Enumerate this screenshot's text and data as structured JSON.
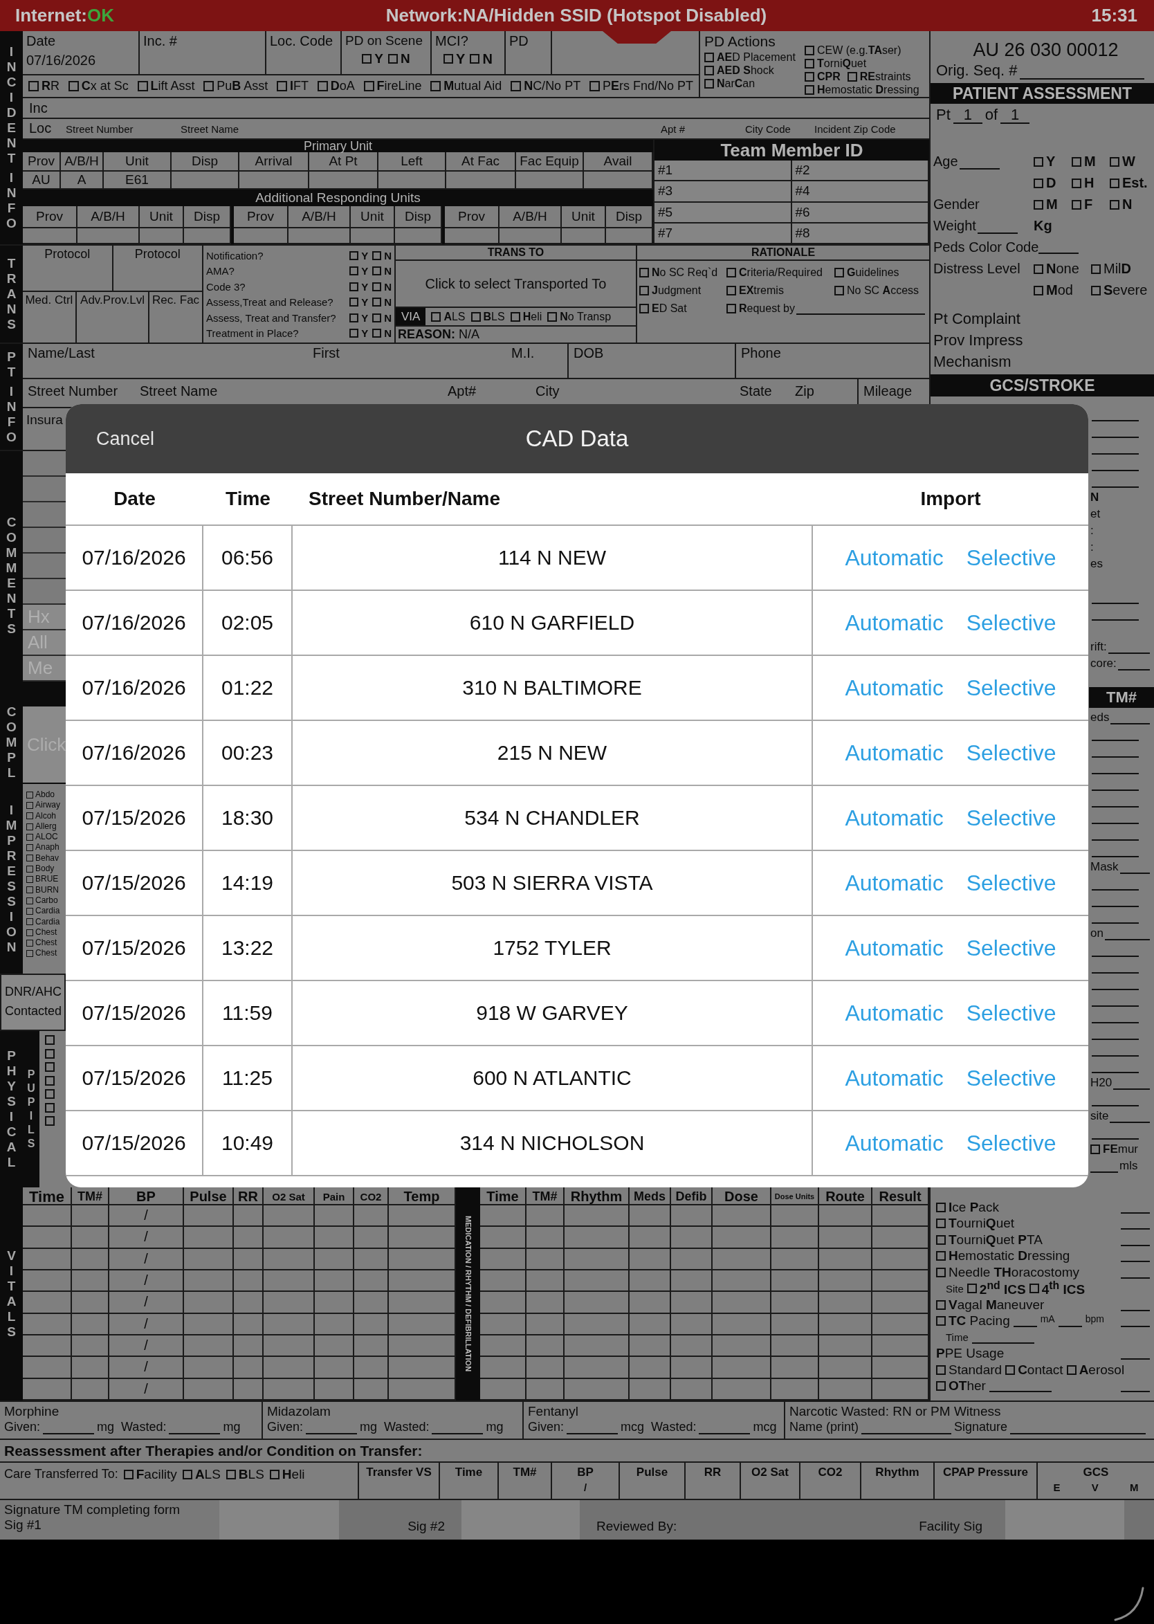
{
  "status_bar": {
    "internet_label": "Internet:",
    "internet_status": "OK",
    "network": "Network:NA/Hidden SSID (Hotspot Disabled)",
    "time": "15:31"
  },
  "side_labels": [
    "INCIDENT INFO",
    "TRANS",
    "PT INFO",
    "COMMENTS",
    "COMPL",
    "IMPRESSION",
    "PHYSICAL",
    "VITALS"
  ],
  "incident": {
    "date_label": "Date",
    "date": "07/16/2026",
    "inc_number_label": "Inc. #",
    "loc_code_label": "Loc. Code",
    "pd_on_scene": {
      "label": "PD on Scene",
      "options": [
        {
          "label": "Y",
          "checked": false
        },
        {
          "label": "N",
          "checked": false
        }
      ]
    },
    "mci": {
      "label": "MCI?",
      "options": [
        {
          "label": "Y",
          "checked": false
        },
        {
          "label": "N",
          "checked": false
        }
      ]
    },
    "pd_label": "PD",
    "pd_actions": {
      "label": "PD Actions",
      "items": [
        {
          "label": "**AE**D Placement",
          "checked": false
        },
        {
          "label": "**AED S**hock",
          "checked": false
        },
        {
          "label": "**N**ar**C**an",
          "checked": false
        },
        {
          "label": "CEW (e.g.**TA**ser)",
          "checked": false
        },
        {
          "label": "**T**orni**Q**uet",
          "checked": false
        },
        {
          "label": "**CPR**",
          "checked": false
        },
        {
          "label": "**RE**straints",
          "checked": false
        },
        {
          "label": "**H**emostatic **D**ressing",
          "checked": false
        }
      ]
    },
    "flags": [
      {
        "label": "**R**R",
        "checked": false
      },
      {
        "label": "**C**x at Sc",
        "checked": false
      },
      {
        "label": "**L**ift Asst",
        "checked": false
      },
      {
        "label": "Pu**B** Asst",
        "checked": false
      },
      {
        "label": "**I**FT",
        "checked": false
      },
      {
        "label": "**D**oA",
        "checked": false
      },
      {
        "label": "**F**ireLine",
        "checked": false
      },
      {
        "label": "**M**utual Aid",
        "checked": false
      },
      {
        "label": "**N**C/No PT",
        "checked": false
      },
      {
        "label": "P**E**rs Fnd/No PT",
        "checked": false
      }
    ],
    "inc_label": "Inc",
    "loc_label": "Loc",
    "loc_fields": [
      "Street Number",
      "Street Name",
      "Apt #",
      "City Code",
      "Incident Zip Code"
    ],
    "primary_unit": {
      "title": "Primary Unit",
      "columns": [
        "Prov",
        "A/B/H",
        "Unit",
        "Disp",
        "Arrival",
        "At Pt",
        "Left",
        "At Fac",
        "Fac Equip",
        "Avail"
      ],
      "values": [
        "AU",
        "A",
        "E61"
      ]
    },
    "additional_units": {
      "title": "Additional Responding Units",
      "groups": [
        [
          "Prov",
          "A/B/H",
          "Unit",
          "Disp"
        ],
        [
          "Prov",
          "A/B/H",
          "Unit",
          "Disp"
        ],
        [
          "Prov",
          "A/B/H",
          "Unit",
          "Disp"
        ]
      ]
    },
    "team": {
      "title": "Team Member ID",
      "slots": [
        "#1",
        "#2",
        "#3",
        "#4",
        "#5",
        "#6",
        "#7",
        "#8"
      ]
    }
  },
  "trans": {
    "protocol_labels": [
      "Protocol",
      "Protocol"
    ],
    "control_labels": [
      "Med. Ctrl",
      "Adv.Prov.Lvl",
      "Rec. Fac"
    ],
    "questions": [
      {
        "label": "Notification?",
        "options": [
          {
            "label": "Y",
            "checked": false
          },
          {
            "label": "N",
            "checked": false
          }
        ]
      },
      {
        "label": "AMA?",
        "options": [
          {
            "label": "Y",
            "checked": false
          },
          {
            "label": "N",
            "checked": false
          }
        ]
      },
      {
        "label": "Code 3?",
        "options": [
          {
            "label": "Y",
            "checked": false
          },
          {
            "label": "N",
            "checked": false
          }
        ]
      },
      {
        "label": "Assess,Treat and Release?",
        "options": [
          {
            "label": "Y",
            "checked": false
          },
          {
            "label": "N",
            "checked": false
          }
        ]
      },
      {
        "label": "Assess, Treat and Transfer?",
        "options": [
          {
            "label": "Y",
            "checked": false
          },
          {
            "label": "N",
            "checked": false
          }
        ]
      },
      {
        "label": "Treatment in Place?",
        "options": [
          {
            "label": "Y",
            "checked": false
          },
          {
            "label": "N",
            "checked": false
          }
        ]
      }
    ],
    "trans_to": {
      "title": "TRANS TO",
      "destination_button": "Click to select Transported To",
      "via_label": "VIA",
      "via_options": [
        {
          "label": "**A**LS",
          "checked": false
        },
        {
          "label": "**B**LS",
          "checked": false
        },
        {
          "label": "**H**eli",
          "checked": false
        },
        {
          "label": "**N**o Transp",
          "checked": false
        }
      ],
      "reason": "**REASON:** N/A"
    },
    "rationale": {
      "title": "RATIONALE",
      "options": [
        {
          "label": "**N**o SC Req`d",
          "checked": false
        },
        {
          "label": "**C**riteria/Required",
          "checked": false
        },
        {
          "label": "**G**uidelines",
          "checked": false
        },
        {
          "label": "**J**udgment",
          "checked": false
        },
        {
          "label": "**EX**tremis",
          "checked": false
        },
        {
          "label": "No SC **A**ccess",
          "checked": false
        },
        {
          "label": "**E**D Sat",
          "checked": false
        },
        {
          "label": "**R**equest by",
          "checked": false
        }
      ]
    }
  },
  "pt_info": {
    "name_fields": [
      "Name/Last",
      "First",
      "M.I.",
      "DOB",
      "Phone"
    ],
    "address_fields": [
      "Street Number",
      "Street Name",
      "Apt#",
      "City",
      "State",
      "Zip",
      "Mileage"
    ],
    "insurance_label": "Insura"
  },
  "assessment": {
    "record_number": "AU 26 030 00012",
    "orig_seq_label": "Orig. Seq. #",
    "title": "PATIENT ASSESSMENT",
    "pt_label": "Pt",
    "pt_number": "1",
    "of_label": "of",
    "pt_total": "1",
    "age_label": "Age",
    "age_options": [
      {
        "label": "Y",
        "checked": false
      },
      {
        "label": "M",
        "checked": false
      },
      {
        "label": "W",
        "checked": false
      },
      {
        "label": "D",
        "checked": false
      },
      {
        "label": "H",
        "checked": false
      },
      {
        "label": "Est.",
        "checked": false
      }
    ],
    "gender_label": "Gender",
    "gender_options": [
      {
        "label": "M",
        "checked": false
      },
      {
        "label": "F",
        "checked": false
      },
      {
        "label": "N",
        "checked": false
      }
    ],
    "weight_label": "Weight",
    "weight_unit": "Kg",
    "peds_color_label": "Peds Color Code",
    "distress_label": "Distress Level",
    "distress_options": [
      {
        "label": "**N**one",
        "checked": false
      },
      {
        "label": "Mil**D**",
        "checked": false
      },
      {
        "label": "**M**od",
        "checked": false
      },
      {
        "label": "**S**evere",
        "checked": false
      }
    ],
    "fields": [
      "Pt Complaint",
      "Prov Impress",
      "Mechanism"
    ],
    "gcs_title": "GCS/STROKE"
  },
  "right_strip": [
    {
      "text": "N",
      "kind": "bold"
    },
    {
      "text": "et",
      "kind": "text"
    },
    {
      "text": ":",
      "kind": "text"
    },
    {
      "text": ":",
      "kind": "text"
    },
    {
      "text": "es",
      "kind": "text"
    },
    {
      "text": "rift:",
      "kind": "field"
    },
    {
      "text": "core:",
      "kind": "field"
    },
    {
      "text": "TM#",
      "kind": "header"
    },
    {
      "text": "eds",
      "kind": "field"
    },
    {
      "text": "Mask",
      "kind": "field"
    },
    {
      "text": "on",
      "kind": "field"
    },
    {
      "text": "H20",
      "kind": "field"
    },
    {
      "text": "site",
      "kind": "field"
    },
    {
      "text": "**FE**mur",
      "kind": "check",
      "checked": false
    },
    {
      "text": "mls",
      "kind": "unit"
    }
  ],
  "comments": {
    "fields": [
      {
        "placeholder": "Hx"
      },
      {
        "placeholder": "All"
      },
      {
        "placeholder": "Me"
      }
    ]
  },
  "complaint": {
    "placeholder": "Click"
  },
  "impressions": [
    {
      "label": "Abdo",
      "checked": false
    },
    {
      "label": "Airway",
      "checked": false
    },
    {
      "label": "Alcoh",
      "checked": false
    },
    {
      "label": "Allerg",
      "checked": false
    },
    {
      "label": "ALOC",
      "checked": false
    },
    {
      "label": "Anaph",
      "checked": false
    },
    {
      "label": "Behav",
      "checked": false
    },
    {
      "label": "Body",
      "checked": false
    },
    {
      "label": "BRUE",
      "checked": false
    },
    {
      "label": "BURN",
      "checked": false
    },
    {
      "label": "Carbo",
      "checked": false
    },
    {
      "label": "Cardia",
      "checked": false
    },
    {
      "label": "Cardia",
      "checked": false
    },
    {
      "label": "Chest",
      "checked": false
    },
    {
      "label": "Chest",
      "checked": false
    },
    {
      "label": "Chest",
      "checked": false
    }
  ],
  "dnr": {
    "label": "DNR/AHC",
    "sublabel": "Contacted"
  },
  "pupils": {
    "label": "PUPILS",
    "options": [
      {
        "checked": false
      },
      {
        "checked": false
      },
      {
        "checked": false
      },
      {
        "checked": false
      },
      {
        "checked": false
      },
      {
        "checked": false
      },
      {
        "checked": false
      }
    ]
  },
  "vitals": {
    "columns": [
      "Time",
      "TM#",
      "BP",
      "Pulse",
      "RR",
      "O2 Sat",
      "Pain",
      "CO2",
      "Temp"
    ],
    "rows": [
      {
        "bp": "/"
      },
      {
        "bp": "/"
      },
      {
        "bp": "/"
      },
      {
        "bp": "/"
      },
      {
        "bp": "/"
      },
      {
        "bp": "/"
      },
      {
        "bp": "/"
      },
      {
        "bp": "/"
      },
      {
        "bp": "/"
      }
    ],
    "strip_label": "MEDICATION / RHYTHM / DEFIBRILLATION",
    "med_columns": [
      "Time",
      "TM#",
      "Rhythm",
      "Meds",
      "Defib",
      "Dose",
      "Dose Units",
      "Route",
      "Result"
    ]
  },
  "procedures": [
    {
      "kind": "check",
      "label": "**I**ce **P**ack",
      "checked": false
    },
    {
      "kind": "check",
      "label": "**T**ourni**Q**uet",
      "checked": false
    },
    {
      "kind": "check",
      "label": "**T**ourni**Q**uet **P**TA",
      "checked": false
    },
    {
      "kind": "check",
      "label": "**H**emostatic **D**ressing",
      "checked": false
    },
    {
      "kind": "check",
      "label": "Needle **TH**oracostomy",
      "checked": false
    },
    {
      "kind": "site",
      "label": "Site",
      "options": [
        {
          "label": "**2**$^{nd}$ **ICS**",
          "checked": false
        },
        {
          "label": "**4**$^{th}$ **ICS**",
          "checked": false
        }
      ]
    },
    {
      "kind": "check",
      "label": "**V**agal **M**aneuver",
      "checked": false
    },
    {
      "kind": "pacing",
      "label": "**TC** Pacing",
      "checked": false,
      "units": [
        "mA",
        "bpm"
      ]
    },
    {
      "kind": "time",
      "label": "Time"
    },
    {
      "kind": "heading",
      "label": "**P**PE Usage"
    },
    {
      "kind": "options",
      "options": [
        {
          "label": "Standard",
          "checked": false
        },
        {
          "label": "**C**ontact",
          "checked": false
        },
        {
          "label": "**A**erosol",
          "checked": false
        }
      ]
    },
    {
      "kind": "other",
      "label": "**OT**her",
      "checked": false
    }
  ],
  "narcotics": [
    {
      "name": "Morphine",
      "given_label": "Given:",
      "given_unit": "mg",
      "wasted_label": "Wasted:",
      "wasted_unit": "mg"
    },
    {
      "name": "Midazolam",
      "given_label": "Given:",
      "given_unit": "mg",
      "wasted_label": "Wasted:",
      "wasted_unit": "mg"
    },
    {
      "name": "Fentanyl",
      "given_label": "Given:",
      "given_unit": "mcg",
      "wasted_label": "Wasted:",
      "wasted_unit": "mcg"
    }
  ],
  "witness": {
    "title": "Narcotic Wasted: RN or PM Witness",
    "name_label": "Name (print)",
    "signature_label": "Signature"
  },
  "reassessment_title": "Reassessment after Therapies and/or Condition on Transfer:",
  "transfer": {
    "label": "Care Transferred To:",
    "options": [
      {
        "label": "**F**acility",
        "checked": false
      },
      {
        "label": "**A**LS",
        "checked": false
      },
      {
        "label": "**B**LS",
        "checked": false
      },
      {
        "label": "**H**eli",
        "checked": false
      }
    ],
    "columns": [
      {
        "label": "Transfer VS"
      },
      {
        "label": "Time"
      },
      {
        "label": "TM#"
      },
      {
        "label": "BP",
        "subs": [
          "/"
        ]
      },
      {
        "label": "Pulse"
      },
      {
        "label": "RR"
      },
      {
        "label": "O2 Sat"
      },
      {
        "label": "CO2"
      },
      {
        "label": "Rhythm"
      },
      {
        "label": "CPAP Pressure"
      },
      {
        "label": "GCS",
        "subs": [
          "E",
          "V",
          "M"
        ]
      }
    ]
  },
  "signatures": {
    "title": "Signature TM completing form",
    "labels": [
      "Sig #1",
      "Sig #2",
      "Reviewed By:",
      "Facility Sig"
    ]
  },
  "dialog": {
    "cancel": "Cancel",
    "title": "CAD Data",
    "columns": [
      "Date",
      "Time",
      "Street Number/Name",
      "Import"
    ],
    "rows": [
      {
        "date": "07/16/2026",
        "time": "06:56",
        "address": "114 N NEW",
        "actions": [
          "Automatic",
          "Selective"
        ]
      },
      {
        "date": "07/16/2026",
        "time": "02:05",
        "address": "610 N GARFIELD",
        "actions": [
          "Automatic",
          "Selective"
        ]
      },
      {
        "date": "07/16/2026",
        "time": "01:22",
        "address": "310 N BALTIMORE",
        "actions": [
          "Automatic",
          "Selective"
        ]
      },
      {
        "date": "07/16/2026",
        "time": "00:23",
        "address": "215 N NEW",
        "actions": [
          "Automatic",
          "Selective"
        ]
      },
      {
        "date": "07/15/2026",
        "time": "18:30",
        "address": "534 N CHANDLER",
        "actions": [
          "Automatic",
          "Selective"
        ]
      },
      {
        "date": "07/15/2026",
        "time": "14:19",
        "address": "503 N SIERRA VISTA",
        "actions": [
          "Automatic",
          "Selective"
        ]
      },
      {
        "date": "07/15/2026",
        "time": "13:22",
        "address": "1752 TYLER",
        "actions": [
          "Automatic",
          "Selective"
        ]
      },
      {
        "date": "07/15/2026",
        "time": "11:59",
        "address": "918 W GARVEY",
        "actions": [
          "Automatic",
          "Selective"
        ]
      },
      {
        "date": "07/15/2026",
        "time": "11:25",
        "address": "600 N ATLANTIC",
        "actions": [
          "Automatic",
          "Selective"
        ]
      },
      {
        "date": "07/15/2026",
        "time": "10:49",
        "address": "314 N NICHOLSON",
        "actions": [
          "Automatic",
          "Selective"
        ]
      }
    ]
  }
}
